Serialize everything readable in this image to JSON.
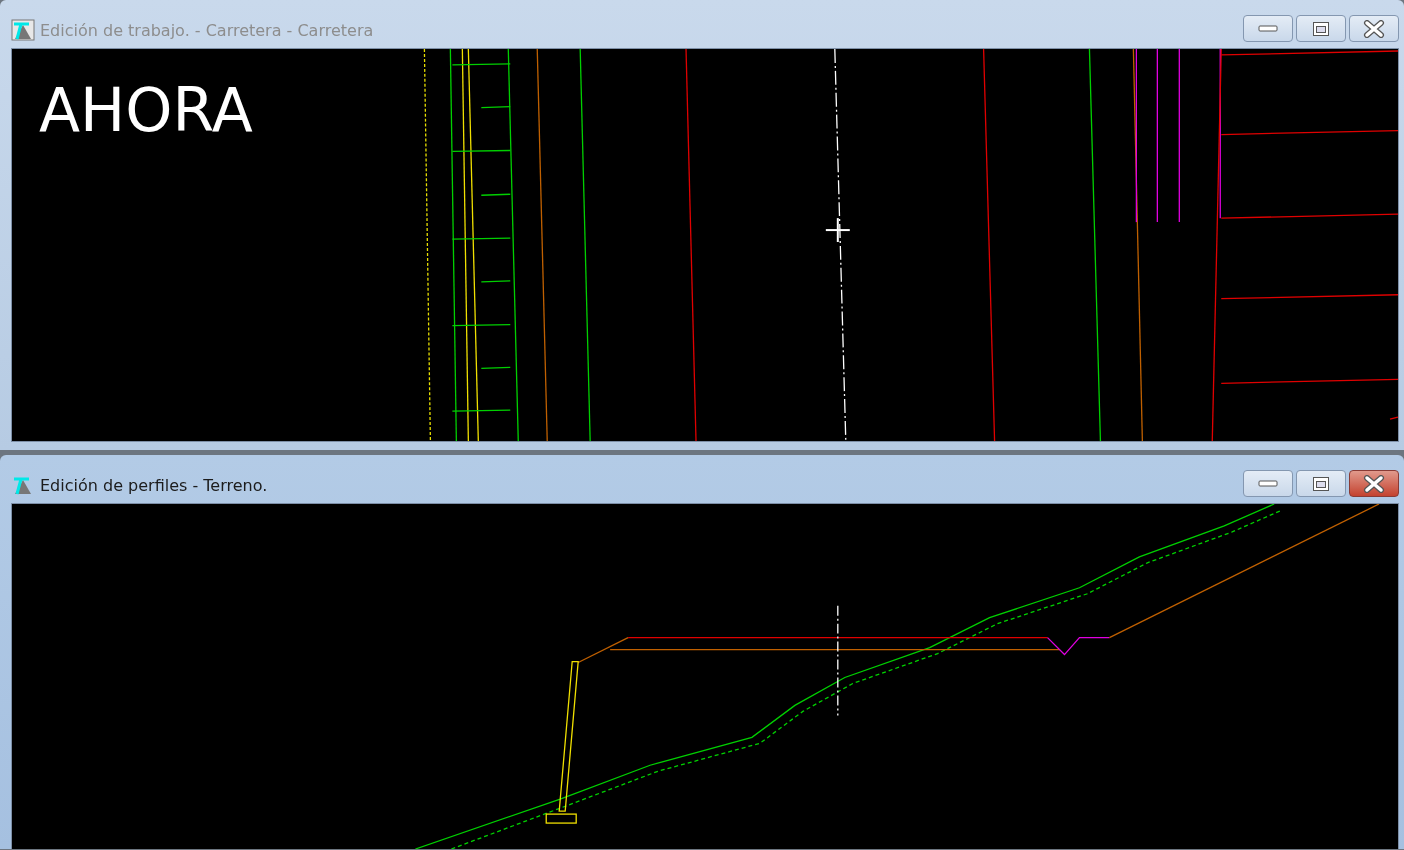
{
  "windows": [
    {
      "title": "Edición de trabajo. - Carretera - Carretera",
      "active": false,
      "kind": "plan",
      "overlay_label": "AHORA"
    },
    {
      "title": "Edición de perfiles - Terreno.",
      "active": true,
      "kind": "profile"
    }
  ]
}
